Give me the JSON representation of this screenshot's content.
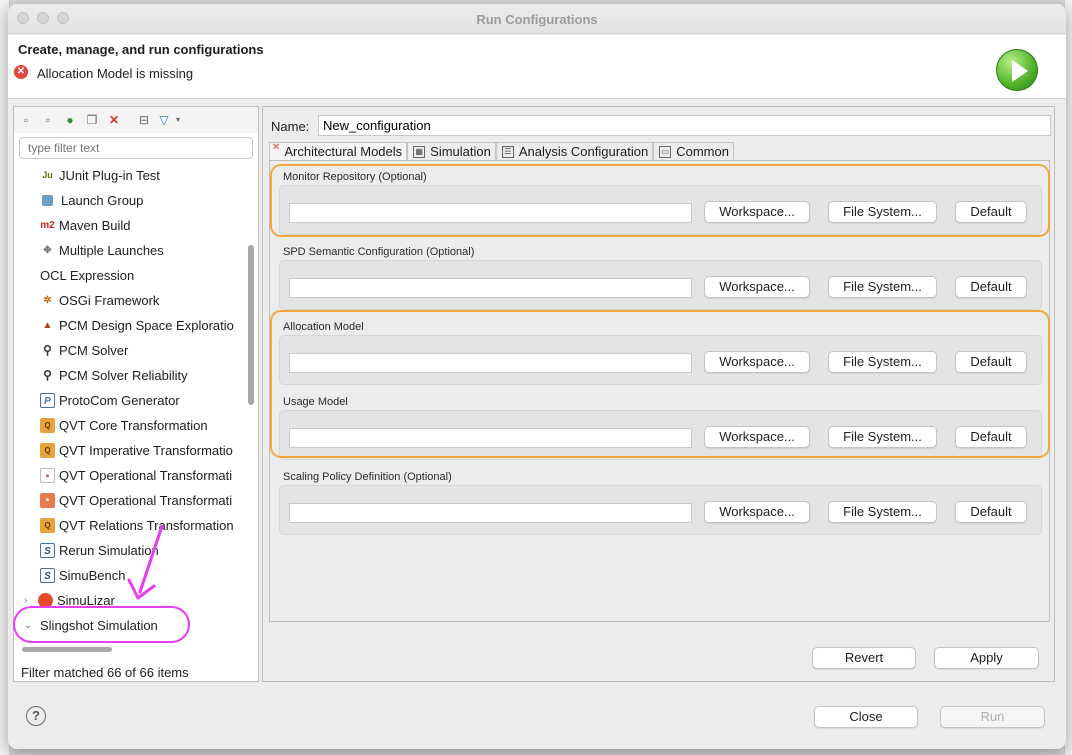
{
  "window": {
    "title": "Run Configurations"
  },
  "header": {
    "title": "Create, manage, and run configurations",
    "error_message": "Allocation Model is missing"
  },
  "left_panel": {
    "filter_placeholder": "type filter text",
    "items": [
      {
        "label": "JUnit Plug-in Test",
        "icon": "junit-plugin-icon"
      },
      {
        "label": "Launch Group",
        "icon": "launch-group-icon"
      },
      {
        "label": "Maven Build",
        "icon": "maven-icon",
        "icon_text": "m2"
      },
      {
        "label": "Multiple Launches",
        "icon": "multiple-launches-icon"
      },
      {
        "label": "OCL Expression",
        "icon": "none"
      },
      {
        "label": "OSGi Framework",
        "icon": "osgi-icon"
      },
      {
        "label": "PCM Design Space Exploratio",
        "icon": "rocket-icon"
      },
      {
        "label": "PCM Solver",
        "icon": "magnifier-icon"
      },
      {
        "label": "PCM Solver Reliability",
        "icon": "magnifier-icon"
      },
      {
        "label": "ProtoCom Generator",
        "icon": "protocom-icon",
        "icon_text": "P"
      },
      {
        "label": "QVT Core Transformation",
        "icon": "qvt-icon"
      },
      {
        "label": "QVT Imperative Transformatio",
        "icon": "qvt-icon"
      },
      {
        "label": "QVT Operational Transformati",
        "icon": "qvt-operational-icon"
      },
      {
        "label": "QVT Operational Transformati",
        "icon": "qvt-operational-icon"
      },
      {
        "label": "QVT Relations Transformation",
        "icon": "qvt-icon"
      },
      {
        "label": "Rerun Simulation",
        "icon": "simulation-icon",
        "icon_text": "S"
      },
      {
        "label": "SimuBench",
        "icon": "simulation-icon",
        "icon_text": "S"
      },
      {
        "label": "SimuLizar",
        "icon": "simulizar-icon"
      },
      {
        "label": "Slingshot Simulation",
        "icon": "none"
      }
    ],
    "filter_status": "Filter matched 66 of 66 items"
  },
  "right_panel": {
    "name_label": "Name:",
    "name_value": "New_configuration",
    "tabs": [
      {
        "label": "Architectural Models",
        "active": true,
        "has_error": true
      },
      {
        "label": "Simulation"
      },
      {
        "label": "Analysis Configuration"
      },
      {
        "label": "Common"
      }
    ],
    "groups": [
      {
        "label": "Monitor Repository (Optional)"
      },
      {
        "label": "SPD Semantic Configuration (Optional)"
      },
      {
        "label": "Allocation Model"
      },
      {
        "label": "Usage Model"
      },
      {
        "label": "Scaling Policy Definition (Optional)"
      }
    ],
    "group_buttons": {
      "workspace": "Workspace...",
      "filesystem": "File System...",
      "default": "Default"
    },
    "revert": "Revert",
    "apply": "Apply"
  },
  "footer": {
    "help": "?",
    "close": "Close",
    "run": "Run"
  },
  "colors": {
    "annotation_orange": "#f0a63c",
    "annotation_pink": "#e83df2",
    "error_red": "#e0463c"
  }
}
